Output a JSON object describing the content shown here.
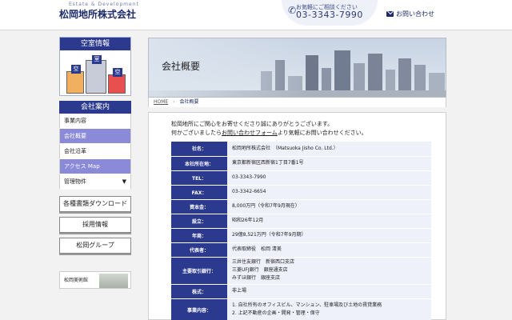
{
  "header": {
    "logo_tagline": "Estate & Development",
    "logo_name": "松岡地所株式会社",
    "phone_note": "お気軽にご相談ください",
    "phone_number": "03-3343-7990",
    "contact_label": "お問い合わせ"
  },
  "sidebar": {
    "vacancy_title": "空室情報",
    "building_labels": [
      "空",
      "室",
      "空"
    ],
    "company_title": "会社案内",
    "menu": [
      {
        "label": "事業内容",
        "style": "white"
      },
      {
        "label": "会社概要",
        "style": "purple"
      },
      {
        "label": "会社沿革",
        "style": "white"
      },
      {
        "label": "アクセス Map",
        "style": "purple"
      },
      {
        "label": "管理物件",
        "style": "white",
        "arrow": "▼"
      }
    ],
    "buttons": [
      "各種書類ダウンロード",
      "採用情報",
      "松岡グループ"
    ],
    "museum_label": "松岡美術館"
  },
  "banner": {
    "title": "会社概要"
  },
  "breadcrumb": {
    "home": "HOME",
    "separator": "›",
    "current": "会社概要"
  },
  "intro": {
    "line1": "松岡地所にご関心をお寄せくださり誠にありがとうございます。",
    "line2_prefix": "何かございましたら",
    "line2_link": "お問い合わせフォーム",
    "line2_suffix": "より気軽にお問い合わせください。"
  },
  "company_table": [
    {
      "label": "社名：",
      "value": [
        "松岡地所株式会社　（Matsuoka Jisho Co. Ltd.）"
      ]
    },
    {
      "label": "本社所在地：",
      "value": [
        "東京都新宿区西新宿1丁目7番1号"
      ]
    },
    {
      "label": "TEL：",
      "value": [
        "03-3343-7990"
      ]
    },
    {
      "label": "FAX：",
      "value": [
        "03-3342-6654"
      ]
    },
    {
      "label": "資本金：",
      "value": [
        "8,000万円（令和7年9月現在）"
      ]
    },
    {
      "label": "設立：",
      "value": [
        "昭和26年12月"
      ]
    },
    {
      "label": "年商：",
      "value": [
        "29億8,521万円（令和7年9月期）"
      ]
    },
    {
      "label": "代表者：",
      "value": [
        "代表取締役　松岡 清美"
      ]
    },
    {
      "label": "主要取引銀行：",
      "value": [
        "三井住友銀行　新宿西口支店",
        "三菱UFJ銀行　銀座通支店",
        "みずほ銀行　銀座支店"
      ]
    },
    {
      "label": "株式：",
      "value": [
        "非上場"
      ]
    },
    {
      "label": "事業内容：",
      "value": [
        "1. 自社所有のオフィスビル、マンション、駐車場及び土地の賃貸業務",
        "2. 上記不動産の企画・開発・管理・保守"
      ]
    }
  ],
  "colors": {
    "navy": "#2b3a8f",
    "purple": "#8a8ad8",
    "cell_bg": "#eef0fa"
  }
}
